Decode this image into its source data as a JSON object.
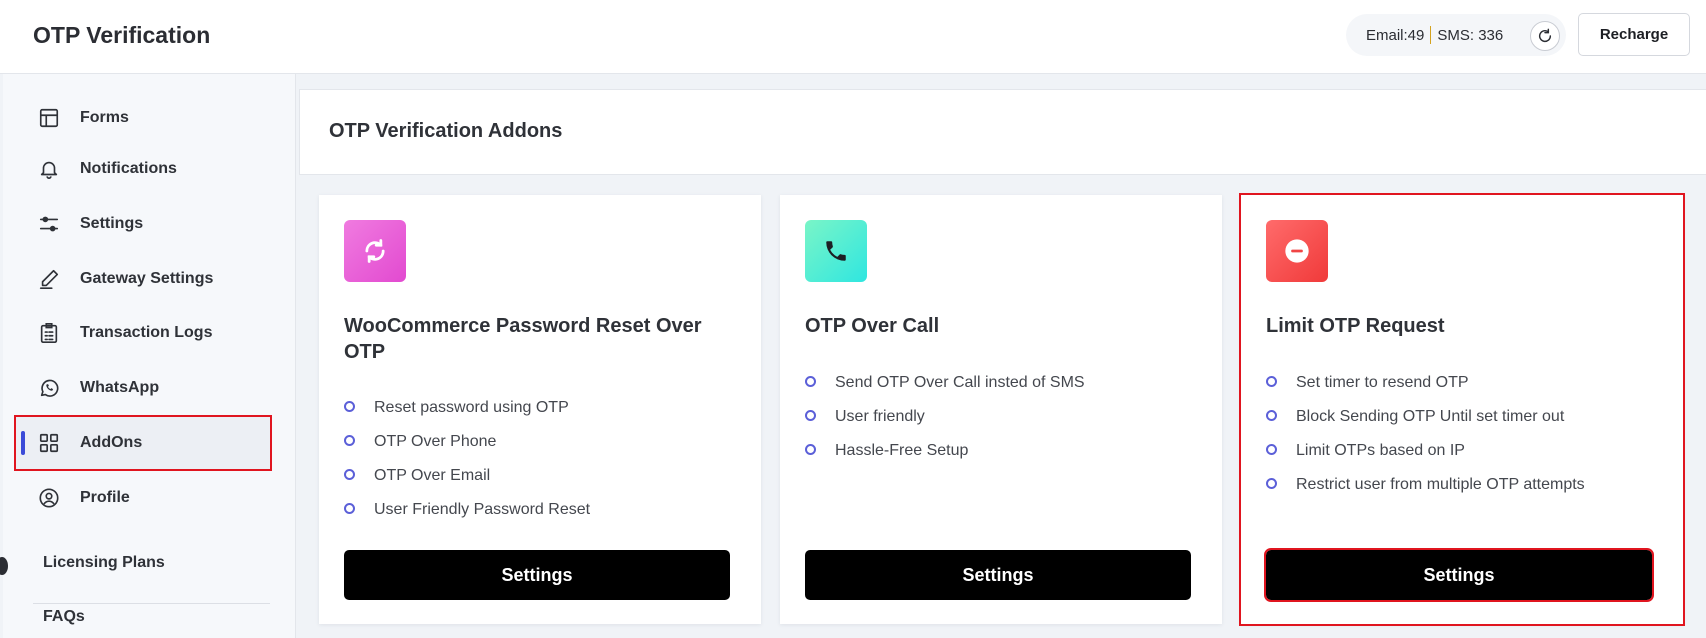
{
  "header": {
    "title": "OTP Verification",
    "quota": {
      "email": "Email:49",
      "sms": "SMS: 336"
    },
    "recharge_label": "Recharge"
  },
  "sidebar": {
    "items": [
      {
        "label": "Forms",
        "icon": "layout-icon"
      },
      {
        "label": "Notifications",
        "icon": "bell-icon"
      },
      {
        "label": "Settings",
        "icon": "sliders-icon"
      },
      {
        "label": "Gateway Settings",
        "icon": "pen-icon"
      },
      {
        "label": "Transaction Logs",
        "icon": "clipboard-list-icon"
      },
      {
        "label": "WhatsApp",
        "icon": "whatsapp-icon"
      },
      {
        "label": "AddOns",
        "icon": "grid-icon",
        "active": true
      },
      {
        "label": "Profile",
        "icon": "user-circle-icon"
      }
    ],
    "links": [
      "Licensing Plans",
      "FAQs"
    ]
  },
  "main": {
    "title": "OTP Verification Addons",
    "cards": [
      {
        "title": "WooCommerce Password Reset Over OTP",
        "icon": "refresh-icon",
        "icon_color": "#e85bd6",
        "features": [
          "Reset password using OTP",
          "OTP Over Phone",
          "OTP Over Email",
          "User Friendly Password Reset"
        ],
        "button": "Settings"
      },
      {
        "title": "OTP Over Call",
        "icon": "phone-icon",
        "icon_color": "#2ee8c0",
        "features": [
          "Send OTP Over Call insted of SMS",
          "User friendly",
          "Hassle-Free Setup"
        ],
        "button": "Settings"
      },
      {
        "title": "Limit OTP Request",
        "icon": "minus-circle-icon",
        "icon_color": "#f04545",
        "features": [
          "Set timer to resend OTP",
          "Block Sending OTP Until set timer out",
          "Limit OTPs based on IP",
          "Restrict user from multiple OTP attempts"
        ],
        "button": "Settings"
      }
    ]
  },
  "colors": {
    "accent": "#3b4bd8",
    "highlight": "#e0151f",
    "bullet": "#5b5fd8"
  }
}
